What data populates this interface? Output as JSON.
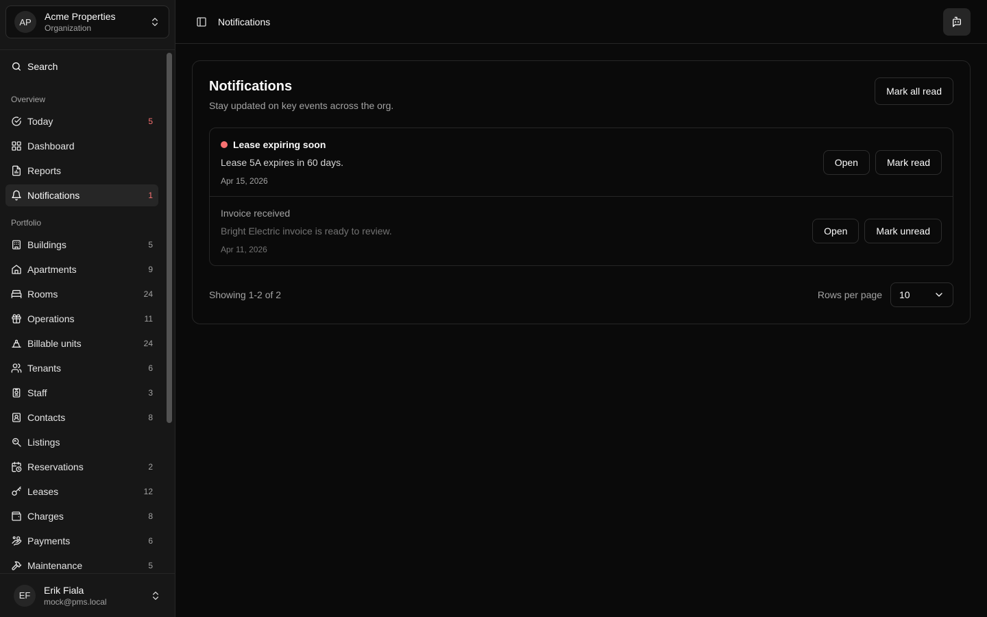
{
  "org": {
    "initials": "AP",
    "name": "Acme Properties",
    "subtitle": "Organization"
  },
  "search": {
    "label": "Search"
  },
  "groups": {
    "overview": "Overview",
    "portfolio": "Portfolio"
  },
  "overview_items": [
    {
      "label": "Today",
      "count": "5",
      "icon": "check-circle-icon"
    },
    {
      "label": "Dashboard",
      "icon": "grid-icon"
    },
    {
      "label": "Reports",
      "icon": "report-icon"
    },
    {
      "label": "Notifications",
      "count": "1",
      "icon": "bell-icon"
    }
  ],
  "portfolio_items": [
    {
      "label": "Buildings",
      "count": "5",
      "icon": "building-icon"
    },
    {
      "label": "Apartments",
      "count": "9",
      "icon": "house-icon"
    },
    {
      "label": "Rooms",
      "count": "24",
      "icon": "bed-icon"
    },
    {
      "label": "Operations",
      "count": "11",
      "icon": "gift-icon"
    },
    {
      "label": "Billable units",
      "count": "24",
      "icon": "lamp-icon"
    },
    {
      "label": "Tenants",
      "count": "6",
      "icon": "users-icon"
    },
    {
      "label": "Staff",
      "count": "3",
      "icon": "badge-icon"
    },
    {
      "label": "Contacts",
      "count": "8",
      "icon": "contact-icon"
    },
    {
      "label": "Listings",
      "icon": "listing-icon"
    },
    {
      "label": "Reservations",
      "count": "2",
      "icon": "calendar-clock-icon"
    },
    {
      "label": "Leases",
      "count": "12",
      "icon": "key-icon"
    },
    {
      "label": "Charges",
      "count": "8",
      "icon": "wallet-icon"
    },
    {
      "label": "Payments",
      "count": "6",
      "icon": "hand-coins-icon"
    },
    {
      "label": "Maintenance",
      "count": "5",
      "icon": "hammer-icon"
    }
  ],
  "user": {
    "initials": "EF",
    "name": "Erik Fiala",
    "email": "mock@pms.local"
  },
  "topbar": {
    "title": "Notifications"
  },
  "card": {
    "title": "Notifications",
    "description": "Stay updated on key events across the org.",
    "mark_all_label": "Mark all read"
  },
  "notifications": [
    {
      "title": "Lease expiring soon",
      "body": "Lease 5A expires in 60 days.",
      "date": "Apr 15, 2026",
      "open_label": "Open",
      "toggle_label": "Mark read",
      "unread": true
    },
    {
      "title": "Invoice received",
      "body": "Bright Electric invoice is ready to review.",
      "date": "Apr 11, 2026",
      "open_label": "Open",
      "toggle_label": "Mark unread",
      "unread": false
    }
  ],
  "pager": {
    "showing": "Showing 1-2 of 2",
    "rows_label": "Rows per page",
    "rows_value": "10"
  },
  "colors": {
    "accent_alert": "#f87171",
    "active_bg": "#262626",
    "background": "#0a0a0a"
  }
}
